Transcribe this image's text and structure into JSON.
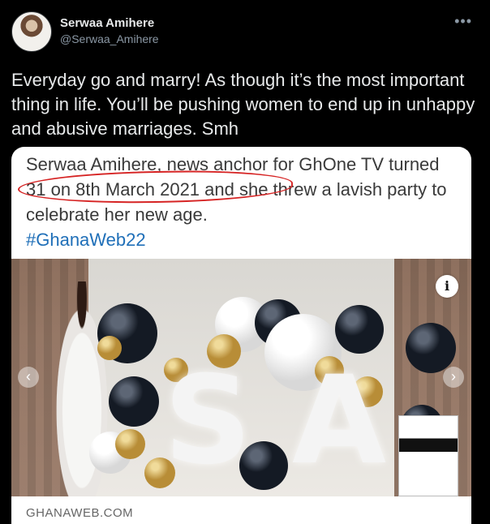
{
  "author": {
    "name": "Serwaa Amihere",
    "handle": "@Serwaa_Amihere"
  },
  "more_icon": "more-horizontal-icon",
  "tweet_text": "Everyday go and marry! As though it’s the most important thing in life. You’ll be pushing women to end up in unhappy and abusive marriages. Smh",
  "card": {
    "headline_part1": "Serwaa Amihere, news anchor for GhOne TV turned 31 on 8th March 2021",
    "headline_part2": " and she threw a lavish party to celebrate her new age.",
    "hashtag": "#GhanaWeb22",
    "source": "GHANAWEB.COM",
    "info_label": "i",
    "prev_arrow": "‹",
    "next_arrow": "›"
  },
  "photo_letters": {
    "s": "S",
    "a": "A"
  },
  "colors": {
    "background": "#000000",
    "text": "#e7e9ea",
    "muted": "#8b98a5",
    "link": "#1f6fb8",
    "annotation": "#d62424"
  }
}
